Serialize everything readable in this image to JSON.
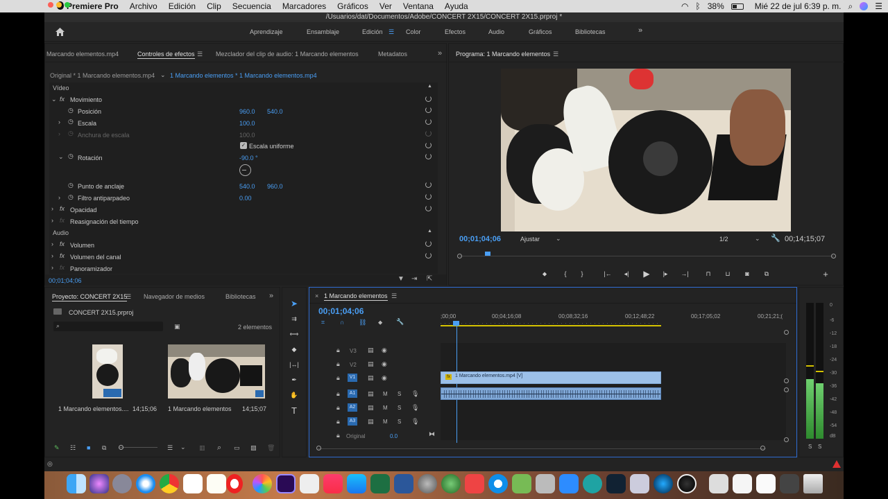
{
  "menubar": {
    "app_name": "Premiere Pro",
    "items": [
      "Archivo",
      "Edición",
      "Clip",
      "Secuencia",
      "Marcadores",
      "Gráficos",
      "Ver",
      "Ventana",
      "Ayuda"
    ],
    "battery": "38%",
    "datetime": "Mié 22 de jul  6:39 p. m."
  },
  "window": {
    "title": "/Usuarios/dat/Documentos/Adobe/CONCERT 2X15/CONCERT 2X15.prproj *"
  },
  "workspaces": {
    "items": [
      "Aprendizaje",
      "Ensamblaje",
      "Edición",
      "Color",
      "Efectos",
      "Audio",
      "Gráficos",
      "Bibliotecas"
    ],
    "active": "Edición"
  },
  "effect_controls": {
    "tabs": [
      "Marcando elementos.mp4",
      "Controles de efectos",
      "Mezclador del clip de audio: 1 Marcando elementos",
      "Metadatos"
    ],
    "source_original": "Original * 1 Marcando elementos.mp4",
    "source_seq": "1 Marcando elementos * 1 Marcando elementos.mp4",
    "video_header": "Vídeo",
    "movimiento": "Movimiento",
    "posicion_label": "Posición",
    "posicion_x": "960.0",
    "posicion_y": "540.0",
    "escala_label": "Escala",
    "escala_val": "100.0",
    "anchura_label": "Anchura de escala",
    "anchura_val": "100.0",
    "escala_uniforme": "Escala uniforme",
    "rotacion_label": "Rotación",
    "rotacion_val": "-90.0 °",
    "anclaje_label": "Punto de anclaje",
    "anclaje_x": "540.0",
    "anclaje_y": "960.0",
    "antiparpadeo_label": "Filtro antiparpadeo",
    "antiparpadeo_val": "0.00",
    "opacidad": "Opacidad",
    "reasignacion": "Reasignación del tiempo",
    "audio_header": "Audio",
    "volumen": "Volumen",
    "volumen_canal": "Volumen del canal",
    "panoramizador": "Panoramizador",
    "timecode": "00;01;04;06"
  },
  "program": {
    "title": "Programa: 1 Marcando elementos",
    "timecode": "00;01;04;06",
    "fit": "Ajustar",
    "resolution": "1/2",
    "duration": "00;14;15;07",
    "playhead_fraction": 0.075
  },
  "project": {
    "tabs": [
      "Proyecto: CONCERT 2X15",
      "Navegador de medios",
      "Bibliotecas"
    ],
    "file": "CONCERT 2X15.prproj",
    "count": "2 elementos",
    "items": [
      {
        "name": "1 Marcando elementos....",
        "duration": "14;15;06"
      },
      {
        "name": "1 Marcando elementos",
        "duration": "14;15;07"
      }
    ]
  },
  "timeline": {
    "tab": "1 Marcando elementos",
    "timecode": "00;01;04;06",
    "ruler": [
      ";00;00",
      "00;04;16;08",
      "00;08;32;16",
      "00;12;48;22",
      "00;17;05;02",
      "00;21;21;("
    ],
    "video_tracks": [
      "V3",
      "V2",
      "V1"
    ],
    "audio_tracks": [
      "A1",
      "A2",
      "A3"
    ],
    "clip_v": "1 Marcando elementos.mp4 [V]",
    "original_label": "Original",
    "original_val": "0.0"
  },
  "meter": {
    "scale": [
      "0",
      "-6",
      "-12",
      "-18",
      "-24",
      "-30",
      "-36",
      "-42",
      "-48",
      "-54",
      "dB"
    ],
    "solo": [
      "S",
      "S"
    ]
  }
}
